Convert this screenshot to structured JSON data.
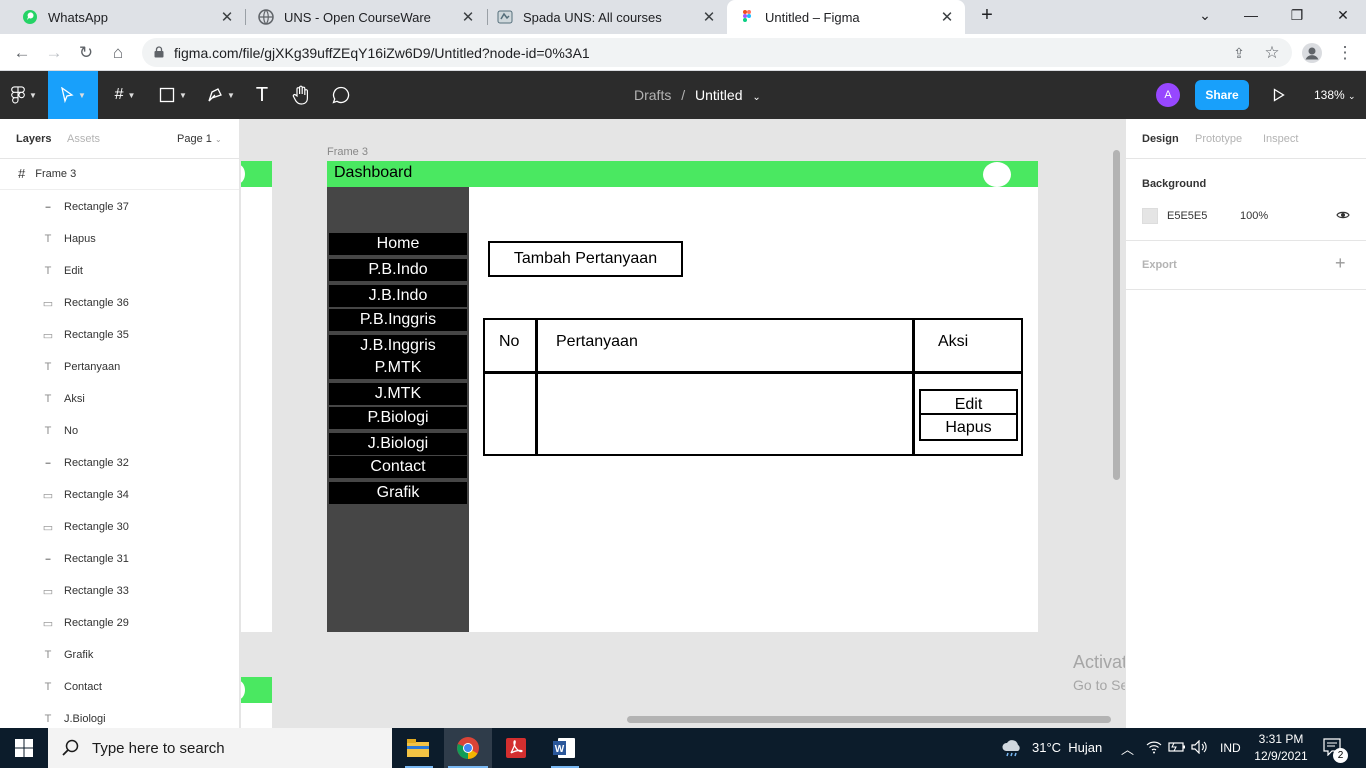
{
  "browser": {
    "tabs": [
      {
        "title": "WhatsApp",
        "icon": "whatsapp-icon"
      },
      {
        "title": "UNS - Open CourseWare",
        "icon": "globe-icon"
      },
      {
        "title": "Spada UNS: All courses",
        "icon": "spada-icon"
      },
      {
        "title": "Untitled – Figma",
        "icon": "figma-icon",
        "active": true
      }
    ],
    "new_tab": "+",
    "url": "figma.com/file/gjXKg39uffZEqY16iZw6D9/Untitled?node-id=0%3A1"
  },
  "figma": {
    "breadcrumb_parent": "Drafts",
    "breadcrumb_sep": "/",
    "file_name": "Untitled",
    "avatar_letter": "A",
    "share_label": "Share",
    "zoom": "138%"
  },
  "left_panel": {
    "tab_layers": "Layers",
    "tab_assets": "Assets",
    "page": "Page 1",
    "frame_name": "Frame 3",
    "layers": [
      {
        "name": "Rectangle 37",
        "icon": "line-icon"
      },
      {
        "name": "Hapus",
        "icon": "text-icon"
      },
      {
        "name": "Edit",
        "icon": "text-icon"
      },
      {
        "name": "Rectangle 36",
        "icon": "rect-icon"
      },
      {
        "name": "Rectangle 35",
        "icon": "rect-icon"
      },
      {
        "name": "Pertanyaan",
        "icon": "text-icon"
      },
      {
        "name": "Aksi",
        "icon": "text-icon"
      },
      {
        "name": "No",
        "icon": "text-icon"
      },
      {
        "name": "Rectangle 32",
        "icon": "line-icon"
      },
      {
        "name": "Rectangle 34",
        "icon": "rect-icon"
      },
      {
        "name": "Rectangle 30",
        "icon": "rect-icon"
      },
      {
        "name": "Rectangle 31",
        "icon": "line-icon"
      },
      {
        "name": "Rectangle 33",
        "icon": "rect-icon"
      },
      {
        "name": "Rectangle 29",
        "icon": "rect-icon"
      },
      {
        "name": "Grafik",
        "icon": "text-icon"
      },
      {
        "name": "Contact",
        "icon": "text-icon"
      },
      {
        "name": "J.Biologi",
        "icon": "text-icon"
      }
    ]
  },
  "right_panel": {
    "tab_design": "Design",
    "tab_prototype": "Prototype",
    "tab_inspect": "Inspect",
    "background_label": "Background",
    "background_hex": "E5E5E5",
    "background_opacity": "100%",
    "export_label": "Export",
    "export_add": "+"
  },
  "canvas": {
    "frame_label": "Frame 3",
    "header_title": "Dashboard",
    "menu_items": [
      "Home",
      "P.B.Indo",
      "J.B.Indo",
      "P.B.Inggris",
      "J.B.Inggris",
      "P.MTK",
      "J.MTK",
      "P.Biologi",
      "J.Biologi",
      "Contact",
      "Grafik"
    ],
    "add_button": "Tambah Pertanyaan",
    "table_headers": {
      "no": "No",
      "question": "Pertanyaan",
      "action": "Aksi"
    },
    "row_actions": {
      "edit": "Edit",
      "delete": "Hapus"
    },
    "activate_title": "Activate Windows",
    "activate_sub": "Go to Settings to activate Windows.",
    "help": "?"
  },
  "taskbar": {
    "search_placeholder": "Type here to search",
    "weather": "31°C  Hujan",
    "lang": "IND",
    "time": "3:31 PM",
    "date": "12/9/2021",
    "notifications": "2"
  },
  "colors": {
    "figma_blue": "#18a0fb",
    "frame_green": "#4ae861",
    "sidebar_gray": "#464646",
    "canvas_bg": "#e5e5e5"
  }
}
